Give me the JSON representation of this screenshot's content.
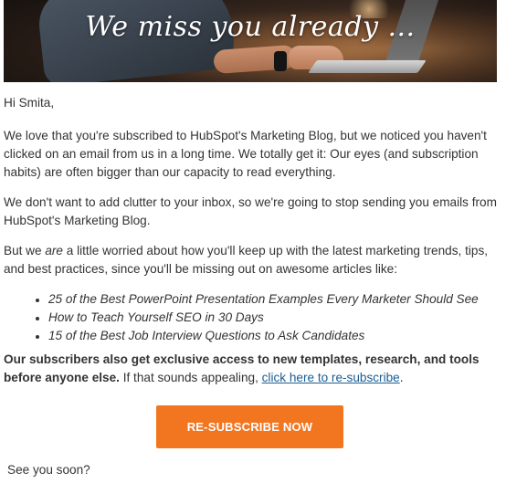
{
  "hero": {
    "title": "We miss you already ..."
  },
  "email": {
    "greeting": "Hi Smita,",
    "para1": "We love that you're subscribed to HubSpot's Marketing Blog, but we noticed you haven't clicked on an email from us in a long time. We totally get it: Our eyes (and subscription habits) are often bigger than our capacity to read everything.",
    "para2": "We don't want to add clutter to your inbox, so we're going to stop sending you emails from HubSpot's Marketing Blog.",
    "para3_before": "But we ",
    "para3_em": "are",
    "para3_after": " a little worried about how you'll keep up with the latest marketing trends, tips, and best practices, since you'll be missing out on awesome articles like:",
    "articles": [
      "25 of the Best PowerPoint Presentation Examples Every Marketer Should See",
      "How to Teach Yourself SEO in 30 Days",
      "15 of the Best Job Interview Questions to Ask Candidates"
    ],
    "para4_bold": "Our subscribers also get exclusive access to new templates, research, and tools before anyone else.",
    "para4_text": " If that sounds appealing, ",
    "para4_link": "click here to re-subscribe",
    "para4_end": ".",
    "cta_label": "RE-SUBSCRIBE NOW",
    "signoff": "See you soon?"
  },
  "colors": {
    "cta": "#f27620",
    "link": "#1a5d94",
    "text": "#333333"
  }
}
